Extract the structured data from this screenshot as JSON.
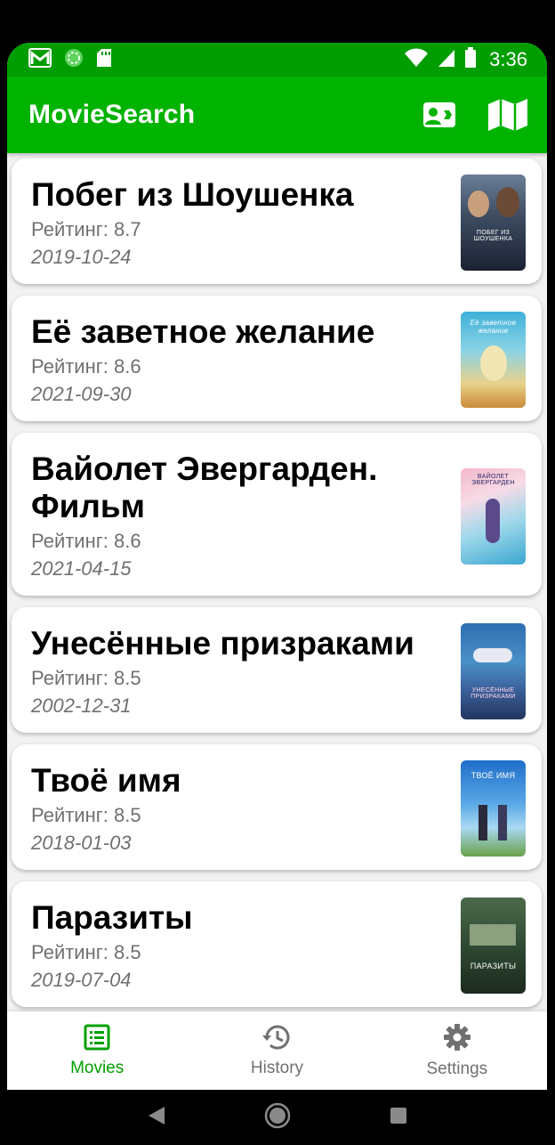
{
  "status_bar": {
    "time": "3:36",
    "icons_left": [
      "gmail-icon",
      "sync-icon",
      "sd-card-icon"
    ],
    "icons_right": [
      "wifi-icon",
      "signal-icon",
      "battery-icon"
    ]
  },
  "app_bar": {
    "title": "MovieSearch",
    "actions": [
      "contact-card-icon",
      "map-icon"
    ]
  },
  "colors": {
    "primary": "#00b300",
    "primary_dark": "#009d00",
    "nav_active": "#00a000",
    "nav_inactive": "#707070"
  },
  "movies": [
    {
      "title": "Побег из Шоушенка",
      "rating": "Рейтинг: 8.7",
      "date": "2019-10-24",
      "poster_text": "ПОБЕГ ИЗ ШОУШЕНКА"
    },
    {
      "title": "Её заветное желание",
      "rating": "Рейтинг: 8.6",
      "date": "2021-09-30",
      "poster_text": "Её заветное желание"
    },
    {
      "title": "Вайолет Эвергарден. Фильм",
      "rating": "Рейтинг: 8.6",
      "date": "2021-04-15",
      "poster_text": "ВАЙОЛЕТ ЭВЕРГАРДЕН"
    },
    {
      "title": "Унесённые призраками",
      "rating": "Рейтинг: 8.5",
      "date": "2002-12-31",
      "poster_text": "УНЕСЁННЫЕ ПРИЗРАКАМИ"
    },
    {
      "title": "Твоё имя",
      "rating": "Рейтинг: 8.5",
      "date": "2018-01-03",
      "poster_text": "ТВОЁ ИМЯ"
    },
    {
      "title": "Паразиты",
      "rating": "Рейтинг: 8.5",
      "date": "2019-07-04",
      "poster_text": "ПАРАЗИТЫ"
    }
  ],
  "bottom_nav": {
    "items": [
      {
        "label": "Movies",
        "icon": "list-icon",
        "active": true
      },
      {
        "label": "History",
        "icon": "history-icon",
        "active": false
      },
      {
        "label": "Settings",
        "icon": "gear-icon",
        "active": false
      }
    ]
  },
  "system_nav": [
    "back-icon",
    "home-icon",
    "recents-icon"
  ]
}
